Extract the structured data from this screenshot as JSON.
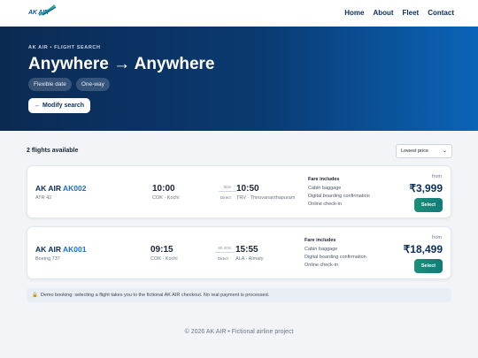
{
  "header": {
    "logo_text": "AK AIR",
    "nav": [
      "Home",
      "About",
      "Fleet",
      "Contact"
    ]
  },
  "hero": {
    "kicker": "AK AIR • FLIGHT SEARCH",
    "route": "Anywhere → Anywhere",
    "chips": [
      "Flexible date",
      "One-way"
    ],
    "modify_label": "← Modify search"
  },
  "results": {
    "count": "2 flights available",
    "sort_selected": "Lowest price",
    "flights": [
      {
        "airline": "AK AIR",
        "code": "AK002",
        "aircraft": "ATR 42",
        "dep_time": "10:00",
        "dep_place": "COK · Kochi",
        "duration": "50m",
        "stops": "Direct",
        "arr_time": "10:50",
        "arr_place": "TRV · Thiruvananthapuram",
        "fare_title": "Fare includes",
        "fare_items": [
          "Cabin baggage",
          "Digital boarding confirmation",
          "Online check-in"
        ],
        "from": "from",
        "price": "₹3,999",
        "select_label": "Select"
      },
      {
        "airline": "AK AIR",
        "code": "AK001",
        "aircraft": "Boeing 737",
        "dep_time": "09:15",
        "dep_place": "COK · Kochi",
        "duration": "6h 40m",
        "stops": "Direct",
        "arr_time": "15:55",
        "arr_place": "ALA · Almaty",
        "fare_title": "Fare includes",
        "fare_items": [
          "Cabin baggage",
          "Digital boarding confirmation",
          "Online check-in"
        ],
        "from": "from",
        "price": "₹18,499",
        "select_label": "Select"
      }
    ]
  },
  "notice": "Demo booking: selecting a flight takes you to the fictional AK AIR checkout. No real payment is processed.",
  "footer": "© 2026 AK AIR • Fictional airline project",
  "colors": {
    "brand_dark": "#0b2e5a",
    "accent": "#1a6fc4",
    "select_button": "#1b8f7a"
  }
}
